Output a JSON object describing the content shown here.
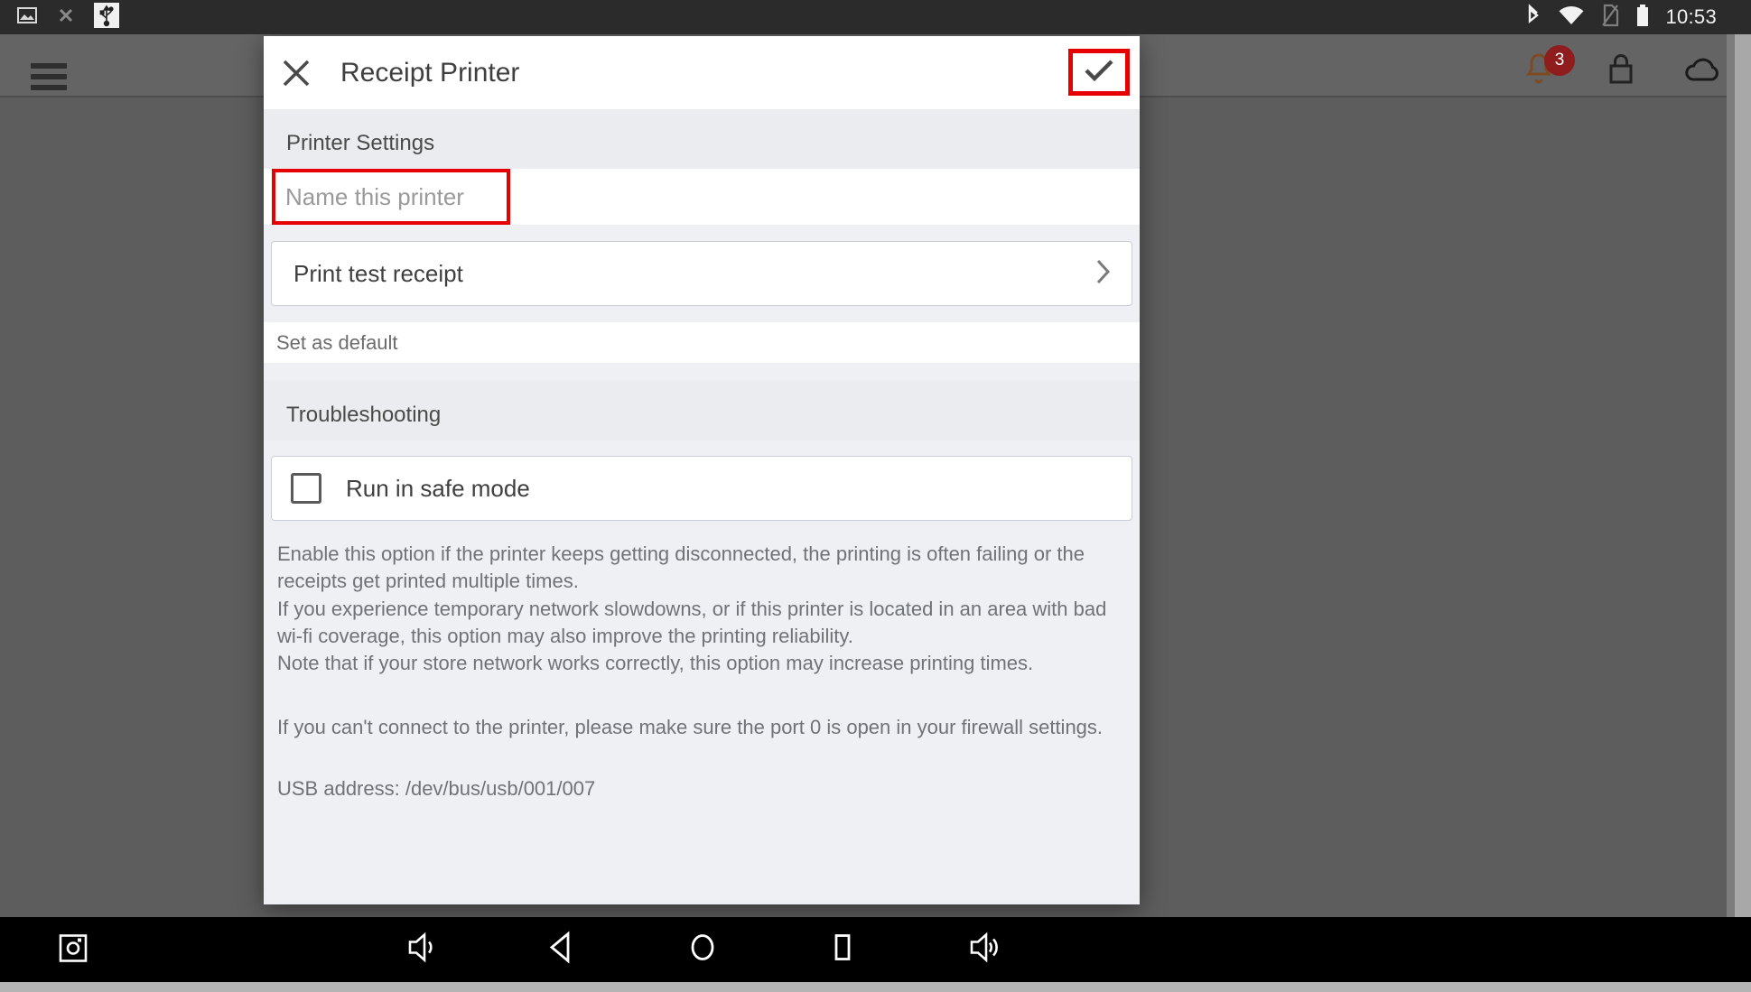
{
  "statusbar": {
    "left_icons": [
      "image-icon",
      "bluetooth-off-icon",
      "usb-icon"
    ],
    "right_icons": [
      "bluetooth-icon",
      "wifi-icon",
      "no-sim-icon",
      "battery-icon"
    ],
    "clock": "10:53"
  },
  "app_background": {
    "menu_icon": "hamburger-menu-icon",
    "notification_icon": "bell-icon",
    "notification_count": "3",
    "lock_icon": "lock-icon",
    "cloud_icon": "cloud-icon"
  },
  "dialog": {
    "title": "Receipt Printer",
    "close_icon": "close-icon",
    "confirm_icon": "check-icon",
    "highlight_color": "#e60000",
    "sections": {
      "printer_settings": {
        "header": "Printer Settings",
        "name_field": {
          "value": "",
          "placeholder": "Name this printer"
        },
        "print_test_receipt": {
          "label": "Print test receipt",
          "chevron_icon": "chevron-right-icon"
        },
        "set_as_default": "Set as default"
      },
      "troubleshooting": {
        "header": "Troubleshooting",
        "safe_mode": {
          "label": "Run in safe mode",
          "checked": false
        },
        "description": "Enable this option if the printer keeps getting disconnected, the printing is often failing or the receipts get printed multiple times.\nIf you experience temporary network slowdowns, or if this printer is located in an area with bad wi-fi coverage, this option may also improve the printing reliability.\nNote that if your store network works correctly, this option may increase printing times.",
        "firewall_note": "If you can't connect to the printer, please make sure the port 0 is open in your firewall settings.",
        "usb_address": "USB address: /dev/bus/usb/001/007"
      }
    }
  },
  "navbar": {
    "items": [
      "screenshot-icon",
      "volume-down-icon",
      "back-icon",
      "home-icon",
      "recents-icon",
      "volume-up-icon"
    ]
  }
}
